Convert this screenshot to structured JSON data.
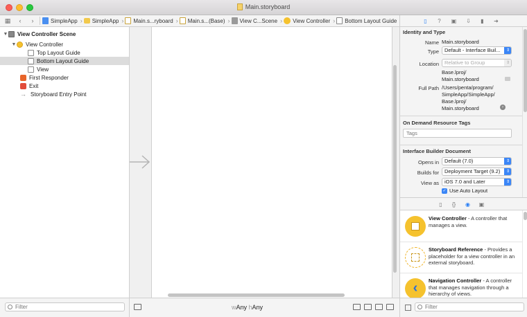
{
  "window": {
    "title": "Main.storyboard"
  },
  "jumpbar": {
    "crumbs": [
      {
        "label": "SimpleApp",
        "icon": "project-icon"
      },
      {
        "label": "SimpleApp",
        "icon": "folder-icon"
      },
      {
        "label": "Main.s...ryboard",
        "icon": "storyboard-file-icon"
      },
      {
        "label": "Main.s...(Base)",
        "icon": "storyboard-file-icon"
      },
      {
        "label": "View C...Scene",
        "icon": "scene-icon"
      },
      {
        "label": "View Controller",
        "icon": "view-controller-icon"
      },
      {
        "label": "Bottom Layout Guide",
        "icon": "layout-guide-icon"
      }
    ]
  },
  "outline": {
    "items": [
      {
        "label": "View Controller Scene"
      },
      {
        "label": "View Controller"
      },
      {
        "label": "Top Layout Guide"
      },
      {
        "label": "Bottom Layout Guide"
      },
      {
        "label": "View"
      },
      {
        "label": "First Responder"
      },
      {
        "label": "Exit"
      },
      {
        "label": "Storyboard Entry Point"
      }
    ],
    "filter_placeholder": "Filter"
  },
  "canvas": {
    "size_class": {
      "w_prefix": "w",
      "w_value": "Any",
      "h_prefix": "h",
      "h_value": "Any"
    }
  },
  "inspector": {
    "identity": {
      "title": "Identity and Type",
      "name_label": "Name",
      "name_value": "Main.storyboard",
      "type_label": "Type",
      "type_value": "Default - Interface Buil...",
      "location_label": "Location",
      "location_value": "Relative to Group",
      "location_path_1": "Base.lproj/",
      "location_path_2": "Main.storyboard",
      "fullpath_label": "Full Path",
      "fullpath_1": "/Users/penta/program/",
      "fullpath_2": "SimpleApp/SimpleApp/",
      "fullpath_3": "Base.lproj/",
      "fullpath_4": "Main.storyboard"
    },
    "tags": {
      "title": "On Demand Resource Tags",
      "placeholder": "Tags"
    },
    "ib_document": {
      "title": "Interface Builder Document",
      "opens_in_label": "Opens in",
      "opens_in_value": "Default (7.0)",
      "builds_for_label": "Builds for",
      "builds_for_value": "Deployment Target (9.2)",
      "view_as_label": "View as",
      "view_as_value": "iOS 7.0 and Later",
      "auto_layout_label": "Use Auto Layout"
    }
  },
  "library": {
    "items": [
      {
        "name": "View Controller",
        "desc": " - A controller that manages a view."
      },
      {
        "name": "Storyboard Reference",
        "desc": " - Provides a placeholder for a view controller in an external storyboard."
      },
      {
        "name": "Navigation Controller",
        "desc": " - A controller that manages navigation through a hierarchy of views."
      }
    ],
    "filter_placeholder": "Filter"
  }
}
